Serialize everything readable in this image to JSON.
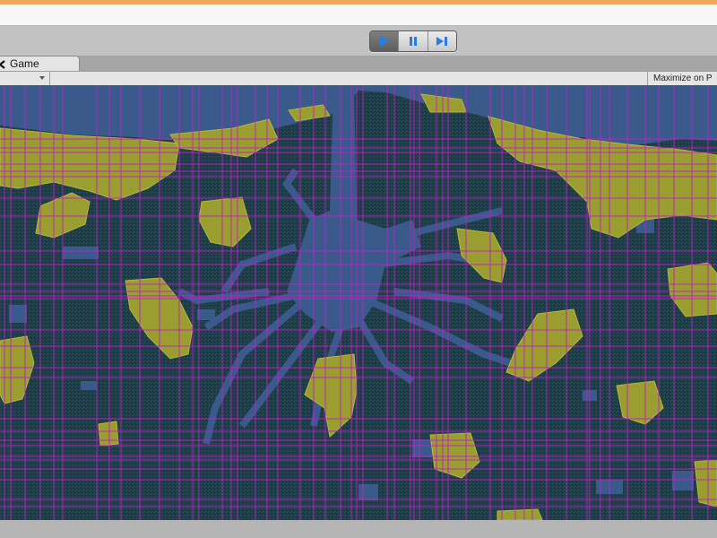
{
  "window": {
    "title": ""
  },
  "toolbar": {
    "play_icon": "play-icon",
    "pause_icon": "pause-icon",
    "step_icon": "step-icon",
    "accent": "#2a7de0"
  },
  "tab": {
    "label": "Game",
    "icon": "game-controller-icon"
  },
  "gamebar": {
    "maximize_label": "Maximize on P"
  },
  "colors": {
    "water": "#3a5a8c",
    "ground": "#1d3d48",
    "land": "#9a9e30",
    "grid": "#c21ec9"
  }
}
